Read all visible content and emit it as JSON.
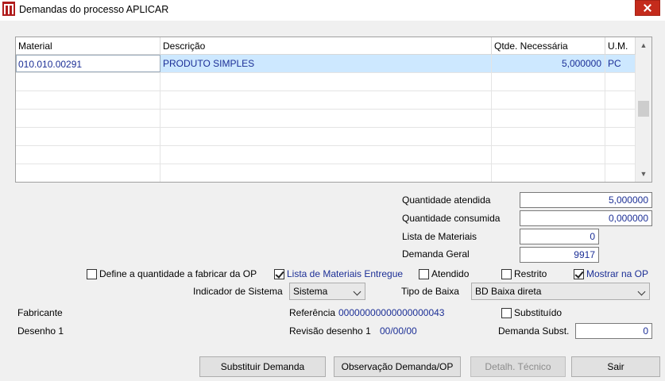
{
  "window": {
    "title": "Demandas do processo APLICAR"
  },
  "grid": {
    "columns": [
      "Material",
      "Descrição",
      "Qtde. Necessária",
      "U.M."
    ],
    "rows": [
      {
        "material": "010.010.00291",
        "descricao": "PRODUTO SIMPLES",
        "qtde": "5,000000",
        "um": "PC"
      }
    ]
  },
  "fields": {
    "quantidade_atendida": {
      "label": "Quantidade atendida",
      "value": "5,000000"
    },
    "quantidade_consumida": {
      "label": "Quantidade consumida",
      "value": "0,000000"
    },
    "lista_materiais": {
      "label": "Lista de Materiais",
      "value": "0"
    },
    "demanda_geral": {
      "label": "Demanda Geral",
      "value": "9917"
    }
  },
  "checkboxes": {
    "define_qtd": {
      "label": "Define a quantidade a fabricar da OP",
      "checked": false
    },
    "lista_entregue": {
      "label": "Lista de Materiais Entregue",
      "checked": true
    },
    "atendido": {
      "label": "Atendido",
      "checked": false
    },
    "restrito": {
      "label": "Restrito",
      "checked": false
    },
    "mostrar_op": {
      "label": "Mostrar na OP",
      "checked": true
    },
    "substituido": {
      "label": "Substituído",
      "checked": false
    }
  },
  "indicador": {
    "label": "Indicador de Sistema",
    "value": "Sistema"
  },
  "tipo_baixa": {
    "label": "Tipo de Baixa",
    "value": "BD Baixa direta"
  },
  "info": {
    "fabricante_label": "Fabricante",
    "desenho_label": "Desenho 1",
    "referencia_label": "Referência",
    "referencia_value": "00000000000000000043",
    "revisao_label": "Revisão desenho 1",
    "revisao_value": "00/00/00",
    "demanda_subst_label": "Demanda Subst.",
    "demanda_subst_value": "0"
  },
  "buttons": {
    "substituir": "Substituir Demanda",
    "observacao": "Observação Demanda/OP",
    "detalhe": "Detalh. Técnico",
    "sair": "Sair"
  }
}
